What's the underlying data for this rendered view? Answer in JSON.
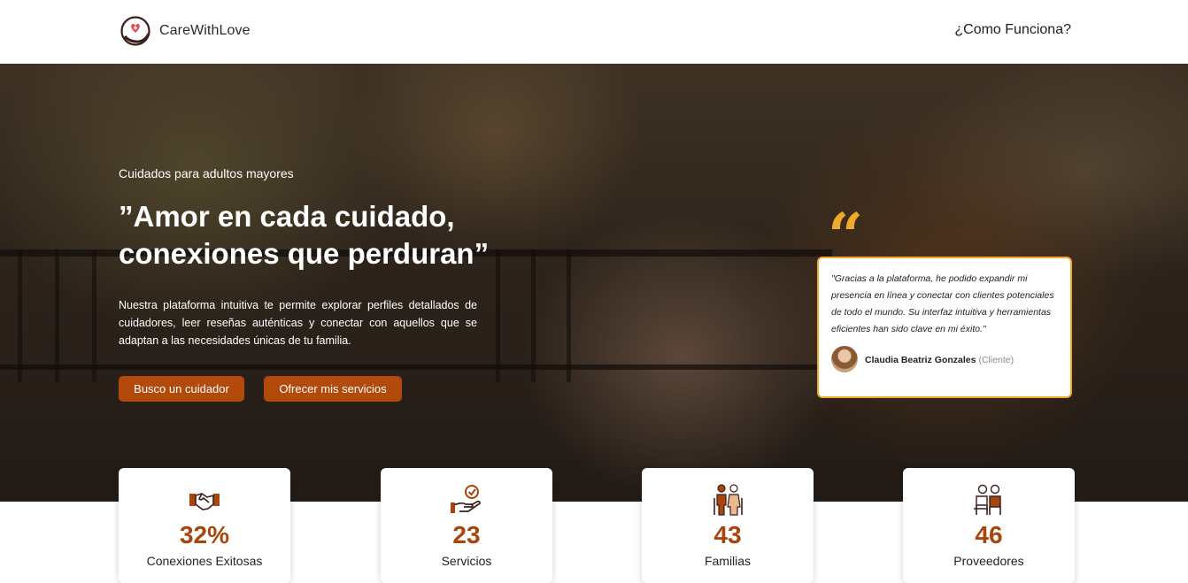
{
  "brand": {
    "name": "CareWithLove",
    "accent": "#b24a0b",
    "highlight": "#f0a92b"
  },
  "nav": {
    "how_it_works": "¿Como Funciona?"
  },
  "hero": {
    "eyebrow": "Cuidados para adultos mayores",
    "title": "”Amor en cada cuidado, conexiones que perduran”",
    "description": "Nuestra plataforma intuitiva te permite explorar perfiles detallados de cuidadores, leer reseñas auténticas y conectar con aquellos que se adaptan a las necesidades únicas de tu familia.",
    "buttons": {
      "find_caregiver": "Busco un cuidador",
      "offer_services": "Ofrecer mis servicios"
    }
  },
  "testimonial": {
    "quote_icon": "“",
    "text": "\"Gracias a la plataforma, he podido expandir mi presencia en línea y conectar con clientes potenciales de todo el mundo. Su interfaz intuitiva y herramientas eficientes han sido clave en mi éxito.\"",
    "author": "Claudia Beatriz Gonzales",
    "role": "(Cliente)"
  },
  "stats": [
    {
      "icon": "handshake-icon",
      "value": "32%",
      "label": "Conexiones Exitosas"
    },
    {
      "icon": "hand-check-icon",
      "value": "23",
      "label": "Servicios"
    },
    {
      "icon": "family-icon",
      "value": "43",
      "label": "Familias"
    },
    {
      "icon": "providers-icon",
      "value": "46",
      "label": "Proveedores"
    }
  ]
}
